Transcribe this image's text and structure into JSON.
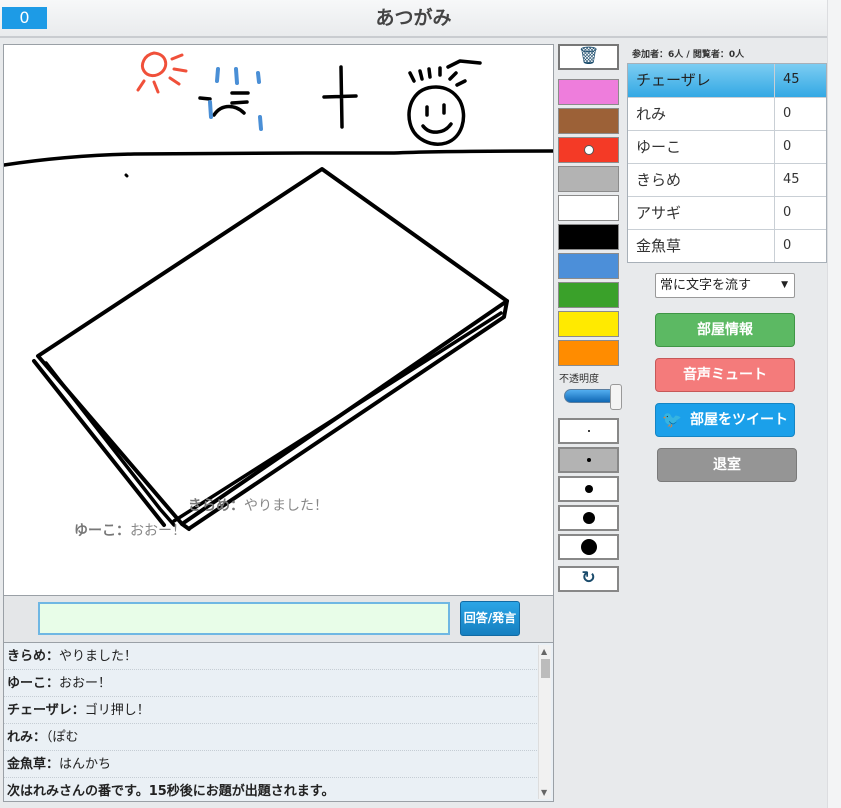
{
  "header": {
    "counter": "0",
    "title": "あつがみ"
  },
  "canvas": {
    "bubbles": [
      {
        "name": "きらめ",
        "sep": "：",
        "text": "やりました！"
      },
      {
        "name": "ゆーこ",
        "sep": "：",
        "text": "おおー！"
      }
    ]
  },
  "input": {
    "value": "",
    "button_label": "回答/発言"
  },
  "chat": {
    "messages": [
      {
        "name": "きらめ",
        "sep": "：",
        "text": "やりました！"
      },
      {
        "name": "ゆーこ",
        "sep": "：",
        "text": "おおー！"
      },
      {
        "name": "チェーザレ",
        "sep": "：",
        "text": "ゴリ押し！"
      },
      {
        "name": "れみ",
        "sep": "：",
        "text": "（ぽむ"
      },
      {
        "name": "金魚草",
        "sep": "：",
        "text": "はんかち"
      }
    ],
    "system": "次はれみさんの番です。15秒後にお題が出題されます。"
  },
  "tools": {
    "colors": [
      "#ee7ddc",
      "#9c6137",
      "#f43a26",
      "#b3b3b3",
      "#ffffff",
      "#000000",
      "#4c8fd9",
      "#3aa12a",
      "#ffea00",
      "#ff8c00"
    ],
    "selected_color_index": 2,
    "opacity_label": "不透明度",
    "opacity_value": 1.0,
    "brush_sizes": [
      2,
      4,
      8,
      12,
      16
    ],
    "selected_brush_index": 1,
    "trash_icon": "trash-icon",
    "undo_icon": "undo-icon"
  },
  "room": {
    "stats": "参加者：6人 / 閲覧者：0人",
    "players": [
      {
        "name": "チェーザレ",
        "score": "45"
      },
      {
        "name": "れみ",
        "score": "0"
      },
      {
        "name": "ゆーこ",
        "score": "0"
      },
      {
        "name": "きらめ",
        "score": "45"
      },
      {
        "name": "アサギ",
        "score": "0"
      },
      {
        "name": "金魚草",
        "score": "0"
      }
    ],
    "active_player_index": 0,
    "flow_select": "常に文字を流す",
    "buttons": {
      "info": "部屋情報",
      "mute": "音声ミュート",
      "tweet": "部屋をツイート",
      "exit": "退室"
    }
  }
}
